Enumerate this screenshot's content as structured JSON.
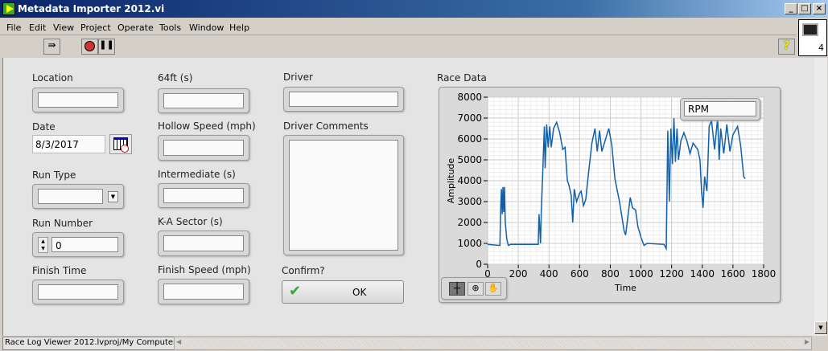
{
  "window": {
    "title": "Metadata Importer 2012.vi",
    "minimize": "_",
    "maximize": "□",
    "close": "×"
  },
  "menu": [
    "File",
    "Edit",
    "View",
    "Project",
    "Operate",
    "Tools",
    "Window",
    "Help"
  ],
  "toolbar": {
    "run_continuous": "run-continuously-icon",
    "abort": "abort-icon",
    "pause": "pause-icon",
    "help": "?",
    "connector_number": "4"
  },
  "fields": {
    "location": {
      "label": "Location",
      "value": ""
    },
    "date": {
      "label": "Date",
      "value": "8/3/2017"
    },
    "run_type": {
      "label": "Run Type",
      "value": ""
    },
    "run_number": {
      "label": "Run Number",
      "value": "0"
    },
    "finish_time": {
      "label": "Finish Time",
      "value": ""
    },
    "ft64": {
      "label": "64ft (s)",
      "value": ""
    },
    "hollow_speed": {
      "label": "Hollow Speed (mph)",
      "value": ""
    },
    "intermediate": {
      "label": "Intermediate (s)",
      "value": ""
    },
    "ka_sector": {
      "label": "K-A Sector (s)",
      "value": ""
    },
    "finish_speed": {
      "label": "Finish Speed (mph)",
      "value": ""
    },
    "driver": {
      "label": "Driver",
      "value": ""
    },
    "driver_comments": {
      "label": "Driver Comments",
      "value": ""
    },
    "confirm": {
      "label": "Confirm?",
      "button": "OK"
    }
  },
  "status": {
    "context": "Race Log Viewer 2012.lvproj/My Computer"
  },
  "chart_data": {
    "type": "line",
    "title": "Race Data",
    "xlabel": "Time",
    "ylabel": "Amplitude",
    "xlim": [
      0,
      1800
    ],
    "ylim": [
      0,
      8000
    ],
    "xticks": [
      0,
      200,
      400,
      600,
      800,
      1000,
      1200,
      1400,
      1600,
      1800
    ],
    "yticks": [
      0,
      1000,
      2000,
      3000,
      4000,
      5000,
      6000,
      7000,
      8000
    ],
    "grid": true,
    "legend_position": "top-right",
    "line_color": "#1460a8",
    "series": [
      {
        "name": "RPM",
        "x": [
          0,
          80,
          85,
          90,
          95,
          100,
          105,
          110,
          115,
          125,
          135,
          150,
          300,
          330,
          335,
          345,
          350,
          360,
          370,
          375,
          385,
          395,
          405,
          415,
          430,
          450,
          470,
          490,
          505,
          520,
          530,
          545,
          555,
          565,
          580,
          600,
          610,
          625,
          640,
          660,
          680,
          700,
          715,
          730,
          745,
          790,
          810,
          830,
          860,
          890,
          900,
          920,
          930,
          945,
          965,
          980,
          1000,
          1020,
          1040,
          1150,
          1165,
          1175,
          1185,
          1195,
          1205,
          1215,
          1225,
          1235,
          1245,
          1260,
          1280,
          1300,
          1320,
          1340,
          1370,
          1385,
          1395,
          1405,
          1415,
          1430,
          1445,
          1460,
          1480,
          1500,
          1510,
          1520,
          1540,
          1560,
          1580,
          1600,
          1630,
          1650,
          1670,
          1680
        ],
        "y": [
          950,
          900,
          2600,
          3600,
          2400,
          3700,
          2500,
          3700,
          2000,
          1200,
          900,
          950,
          950,
          950,
          2400,
          1000,
          2600,
          4500,
          6600,
          4600,
          6700,
          5600,
          6600,
          5600,
          6500,
          6800,
          6300,
          5500,
          5600,
          4000,
          3800,
          3300,
          2000,
          3600,
          3000,
          3400,
          3500,
          2800,
          3100,
          4500,
          5800,
          6500,
          5400,
          6400,
          5400,
          6500,
          5700,
          4100,
          3000,
          1600,
          1400,
          2600,
          3200,
          2700,
          2600,
          1800,
          1300,
          900,
          1000,
          950,
          750,
          6400,
          3000,
          6500,
          4800,
          7000,
          4900,
          6500,
          5000,
          5900,
          6300,
          5900,
          5300,
          5800,
          5500,
          5000,
          3500,
          2700,
          4200,
          3500,
          6600,
          6900,
          5500,
          7000,
          5000,
          6500,
          5300,
          6700,
          5400,
          6200,
          6600,
          5700,
          4200,
          4100
        ]
      }
    ]
  }
}
